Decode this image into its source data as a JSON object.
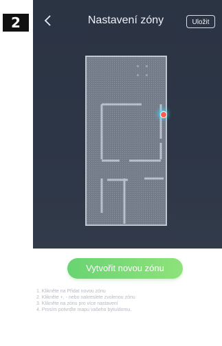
{
  "step": {
    "number": "2"
  },
  "header": {
    "title": "Nastavení zóny",
    "save_label": "Uložit"
  },
  "icons": {
    "back": "chevron-left-icon",
    "robot": "robot-marker",
    "dock": "charging-dock-icon"
  },
  "actions": {
    "create_zone_label": "Vytvořit novou zónu"
  },
  "instructions": [
    "1. Klikněte na Přidat novou zónu",
    "2. Klikněte +, - nebo nakreslete zvolenou zónu",
    "3. Klikněte na zónu pro více nastavení",
    "4. Prosím potvrďte mapu vašeho bytu/domu."
  ],
  "colors": {
    "map_background": "#2d3646",
    "map_floor": "#7d8593",
    "map_wall": "#b5bcc7",
    "accent_green": "#7ad977",
    "instruction_text": "#b4b9c1"
  }
}
